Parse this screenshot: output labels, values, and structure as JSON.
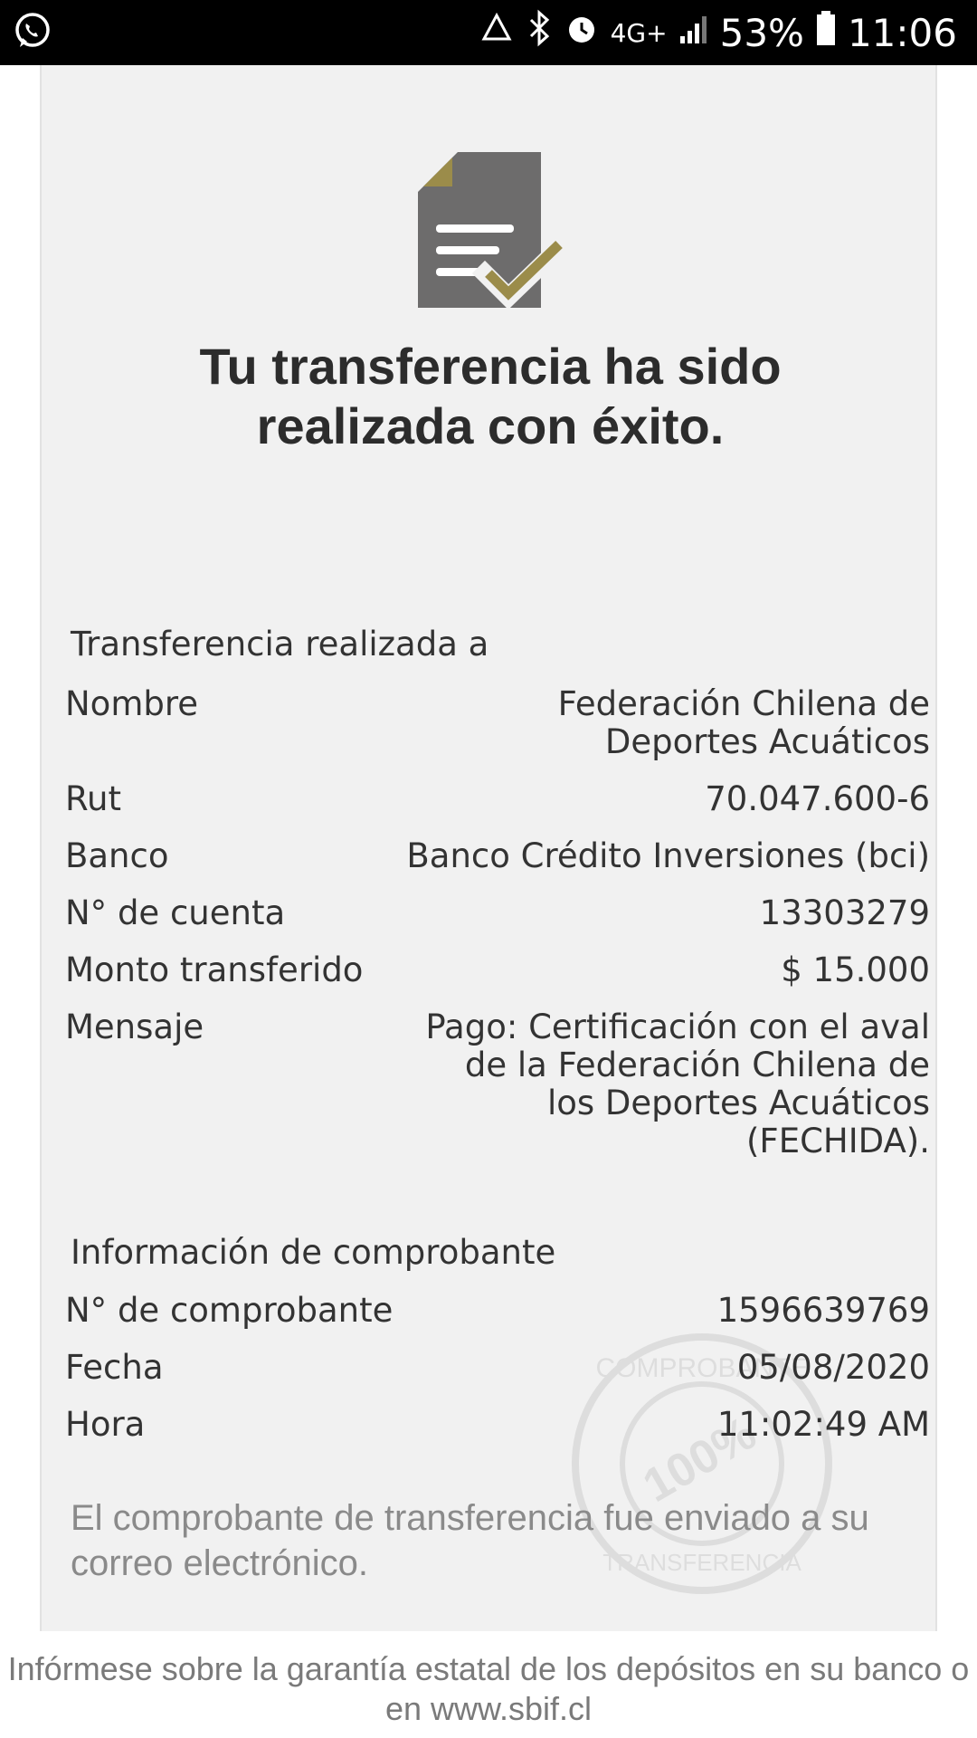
{
  "status_bar": {
    "network": "4G+",
    "battery": "53%",
    "time": "11:06"
  },
  "headline": {
    "line1": "Tu transferencia ha sido",
    "line2": "realizada con éxito."
  },
  "transfer": {
    "section_title": "Transferencia realizada a",
    "rows": [
      {
        "label": "Nombre",
        "value": "Federación Chilena de Deportes Acuáticos"
      },
      {
        "label": "Rut",
        "value": "70.047.600-6"
      },
      {
        "label": "Banco",
        "value": "Banco Crédito Inversiones (bci)"
      },
      {
        "label": "N° de cuenta",
        "value": "13303279"
      },
      {
        "label": "Monto transferido",
        "value": "$ 15.000"
      },
      {
        "label": "Mensaje",
        "value": "Pago: Certificación con el aval de la Federación Chilena de los Deportes Acuáticos (FECHIDA)."
      }
    ]
  },
  "voucher": {
    "section_title": "Información de comprobante",
    "rows": [
      {
        "label": "N°  de comprobante",
        "value": "1596639769"
      },
      {
        "label": "Fecha",
        "value": "05/08/2020"
      },
      {
        "label": "Hora",
        "value": "11:02:49 AM"
      }
    ]
  },
  "note": "El comprobante de transferencia fue enviado a su correo electrónico.",
  "stamp": {
    "text_top": "COMPROBANTE",
    "text_center": "100%",
    "text_bottom": "TRANSFERENCIA"
  },
  "footer": "Infórmese sobre la garantía estatal de los depósitos en su banco o en www.sbif.cl",
  "colors": {
    "accent_gold": "#9b8c4a",
    "doc_gray": "#6d6c6c"
  }
}
